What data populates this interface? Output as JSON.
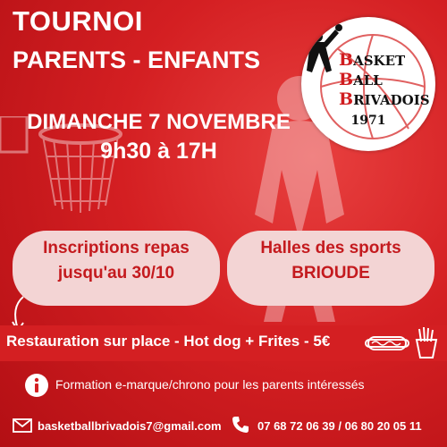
{
  "title": {
    "line1": "TOURNOI",
    "line2": "PARENTS - ENFANTS"
  },
  "event": {
    "date": "DIMANCHE 7 NOVEMBRE",
    "time": "9h30 à 17H"
  },
  "logo": {
    "line1_cap": "B",
    "line1_rest": "ASKET",
    "line2_cap": "B",
    "line2_rest": "ALL",
    "line3_cap": "B",
    "line3_rest": "RIVADOIS",
    "year": "1971"
  },
  "registration": {
    "line1": "Inscriptions repas",
    "line2": "jusqu'au 30/10"
  },
  "venue": {
    "line1": "Halles des sports",
    "line2": "BRIOUDE"
  },
  "food": {
    "text": "Restauration sur place - Hot dog + Frites - 5€"
  },
  "info": {
    "text": "Formation e-marque/chrono pour les parents intéressés"
  },
  "contact": {
    "email": "basketballbrivadois7@gmail.com",
    "phone": "07 68 72 06 39 / 06 80 20 05 11"
  },
  "colors": {
    "primary_red": "#d41f22",
    "cloud": "#f3d4d4",
    "accent_text": "#c41a1e"
  },
  "icons": [
    "info-icon",
    "mail-icon",
    "phone-icon",
    "hotdog-icon",
    "fries-icon",
    "arrow-icon",
    "basketball-player-icon",
    "hoop-icon"
  ]
}
